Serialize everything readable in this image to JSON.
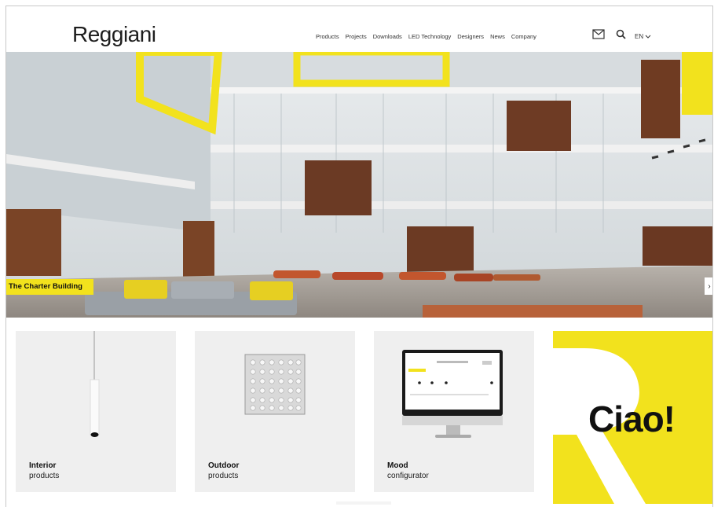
{
  "header": {
    "logo": "Reggiani",
    "nav": [
      "Products",
      "Projects",
      "Downloads",
      "LED Technology",
      "Designers",
      "News",
      "Company"
    ],
    "language": "EN",
    "icons": [
      "mail-icon",
      "search-icon",
      "chevron-down-icon"
    ]
  },
  "hero": {
    "caption": "The Charter Building",
    "next_icon": "chevron-right-icon"
  },
  "cards": [
    {
      "title": "Interior",
      "subtitle": "products"
    },
    {
      "title": "Outdoor",
      "subtitle": "products"
    },
    {
      "title": "Mood",
      "subtitle": "configurator"
    }
  ],
  "promo": {
    "text": "Ciao!"
  },
  "colors": {
    "brand_yellow": "#f2e21d",
    "card_bg": "#efefef",
    "text": "#1e1e1e"
  }
}
